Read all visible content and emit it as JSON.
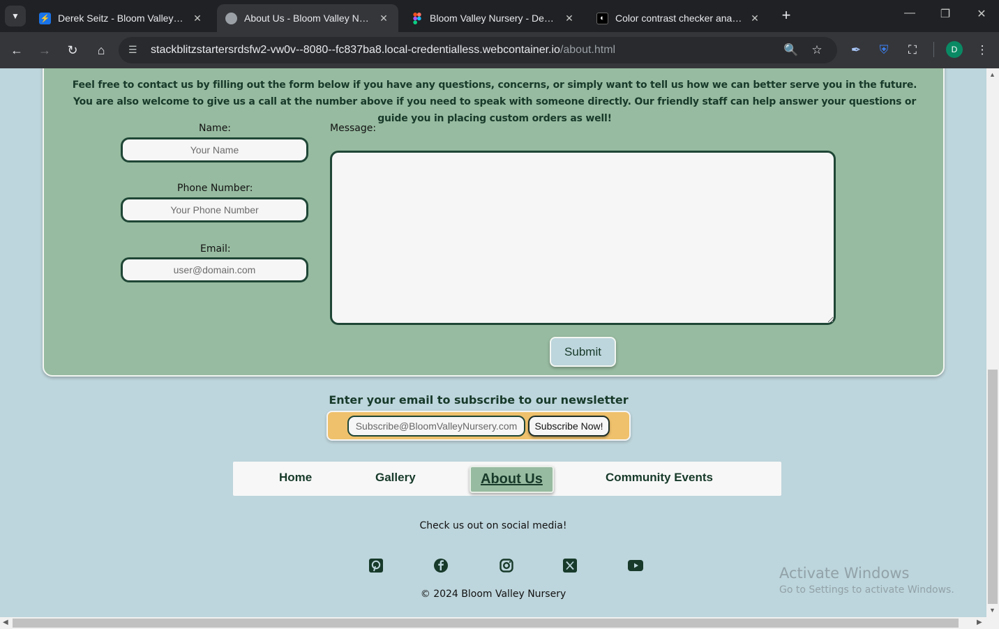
{
  "browser": {
    "tabs": [
      {
        "title": "Derek Seitz - Bloom Valley Nurs",
        "active": false
      },
      {
        "title": "About Us - Bloom Valley Nurser",
        "active": true
      },
      {
        "title": "Bloom Valley Nursery - Desktop",
        "active": false
      },
      {
        "title": "Color contrast checker analyzer",
        "active": false
      }
    ],
    "url_host": "stackblitzstartersrdsfw2-vw0v--8080--fc837ba8.local-credentialless.webcontainer.io",
    "url_path": "/about.html",
    "profile_initial": "D"
  },
  "contact": {
    "intro": "Feel free to contact us by filling out the form below if you have any questions, concerns, or simply want to tell us how we can better serve you in the future. You are also welcome to give us a call at the number above if you need to speak with someone directly. Our friendly staff can help answer your questions or guide you in placing custom orders as well!",
    "name_label": "Name:",
    "name_placeholder": "Your Name",
    "phone_label": "Phone Number:",
    "phone_placeholder": "Your Phone Number",
    "email_label": "Email:",
    "email_placeholder": "user@domain.com",
    "message_label": "Message:",
    "submit_label": "Submit"
  },
  "newsletter": {
    "title": "Enter your email to subscribe to our newsletter",
    "placeholder": "Subscribe@BloomValleyNursery.com",
    "button_label": "Subscribe Now!"
  },
  "footer": {
    "nav": [
      {
        "label": "Home",
        "active": false
      },
      {
        "label": "Gallery",
        "active": false
      },
      {
        "label": "About Us",
        "active": true
      },
      {
        "label": "Community Events",
        "active": false
      }
    ],
    "social_text": "Check us out on social media!",
    "social_icons": [
      "pinterest-icon",
      "facebook-icon",
      "instagram-icon",
      "x-twitter-icon",
      "youtube-icon"
    ],
    "copyright": "© 2024 Bloom Valley Nursery"
  },
  "watermark": {
    "title": "Activate Windows",
    "subtitle": "Go to Settings to activate Windows."
  },
  "colors": {
    "page_bg": "#bdd5dc",
    "card_green": "#97bba0",
    "dark_green": "#1f4636",
    "newsletter_gold": "#efc16c"
  }
}
